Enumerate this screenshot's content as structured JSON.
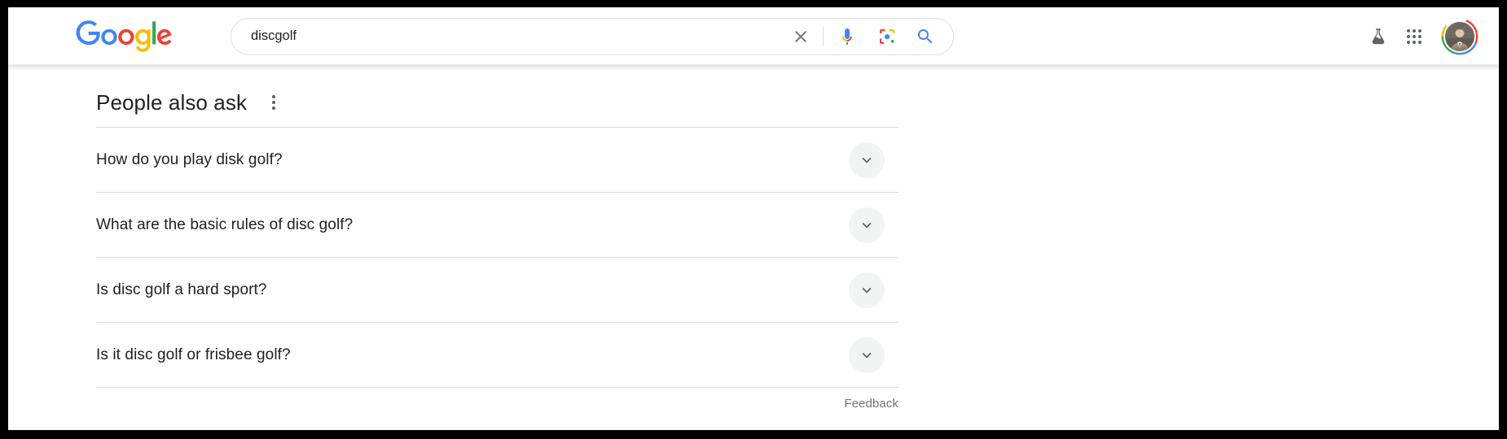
{
  "brand": {
    "logo_text": "Google",
    "logo_letters": [
      "G",
      "o",
      "o",
      "g",
      "l",
      "e"
    ],
    "colors": {
      "blue": "#4285F4",
      "red": "#EA4335",
      "yellow": "#FBBC05",
      "green": "#34A853",
      "text": "#202124",
      "secondary_text": "#70757a",
      "divider": "#dadce0",
      "chip_bg": "#f1f3f4",
      "search_border": "#dfe1e5"
    }
  },
  "search": {
    "value": "discgolf",
    "placeholder": "Search",
    "clear_icon": "close-icon",
    "mic_icon": "microphone-icon",
    "lens_icon": "google-lens-icon",
    "search_icon": "search-icon"
  },
  "header": {
    "labs_icon": "labs-flask-icon",
    "apps_icon": "google-apps-grid-icon",
    "avatar_icon": "account-avatar"
  },
  "main": {
    "section_title": "People also ask",
    "overflow_icon": "three-dots-vertical-icon",
    "questions": [
      {
        "text": "How do you play disk golf?",
        "expand_icon": "chevron-down-icon"
      },
      {
        "text": "What are the basic rules of disc golf?",
        "expand_icon": "chevron-down-icon"
      },
      {
        "text": "Is disc golf a hard sport?",
        "expand_icon": "chevron-down-icon"
      },
      {
        "text": "Is it disc golf or frisbee golf?",
        "expand_icon": "chevron-down-icon"
      }
    ],
    "feedback_label": "Feedback"
  }
}
